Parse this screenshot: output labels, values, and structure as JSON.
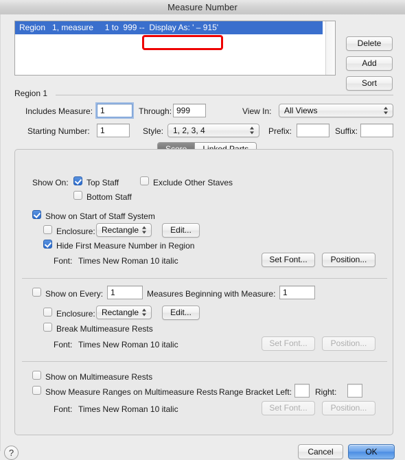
{
  "window": {
    "title": "Measure Number"
  },
  "region_list": {
    "rows": [
      {
        "text": "Region   1, measure     1 to  999 --  Display As: ' – 915'"
      }
    ],
    "annotation": {
      "label": "Display As: ' – 915'",
      "color": "#ee0000"
    }
  },
  "side_buttons": [
    {
      "label": "Delete"
    },
    {
      "label": "Add"
    },
    {
      "label": "Sort"
    }
  ],
  "region_group": {
    "title": "Region 1",
    "includes_measure_label": "Includes Measure:",
    "includes_measure_value": "1",
    "through_label": "Through:",
    "through_value": "999",
    "view_in_label": "View In:",
    "view_in_value": "All Views",
    "starting_number_label": "Starting Number:",
    "starting_number_value": "1",
    "style_label": "Style:",
    "style_value": "1, 2, 3, 4",
    "prefix_label": "Prefix:",
    "prefix_value": "",
    "suffix_label": "Suffix:",
    "suffix_value": ""
  },
  "tabs": [
    {
      "label": "Score",
      "selected": true
    },
    {
      "label": "Linked Parts",
      "selected": false
    }
  ],
  "section_staff": {
    "show_on_label": "Show On:",
    "top_staff_label": "Top Staff",
    "exclude_other_staves_label": "Exclude Other Staves",
    "bottom_staff_label": "Bottom Staff",
    "show_on_start_label": "Show on Start of Staff System",
    "enclosure_label": "Enclosure:",
    "enclosure_value": "Rectangle",
    "edit_label": "Edit...",
    "hide_first_label": "Hide First Measure Number in Region",
    "font_label": "Font:",
    "font_value": "Times New Roman 10  italic",
    "set_font_label": "Set Font...",
    "position_label": "Position..."
  },
  "section_every": {
    "show_on_every_label": "Show on Every:",
    "every_value": "1",
    "measures_beginning_label": "Measures Beginning with Measure:",
    "beginning_value": "1",
    "enclosure_label": "Enclosure:",
    "enclosure_value": "Rectangle",
    "edit_label": "Edit...",
    "break_multimeasure_label": "Break Multimeasure Rests",
    "font_label": "Font:",
    "font_value": "Times New Roman 10  italic",
    "set_font_label": "Set Font...",
    "position_label": "Position..."
  },
  "section_multimeasure": {
    "show_on_multimeasure_label": "Show on Multimeasure Rests",
    "show_ranges_label": "Show Measure Ranges on Multimeasure Rests",
    "range_bracket_left_label": "Range Bracket Left:",
    "range_bracket_left_value": "",
    "range_bracket_right_label": "Right:",
    "range_bracket_right_value": "",
    "font_label": "Font:",
    "font_value": "Times New Roman 10  italic",
    "set_font_label": "Set Font...",
    "position_label": "Position..."
  },
  "footer": {
    "help_label": "?",
    "cancel_label": "Cancel",
    "ok_label": "OK"
  }
}
